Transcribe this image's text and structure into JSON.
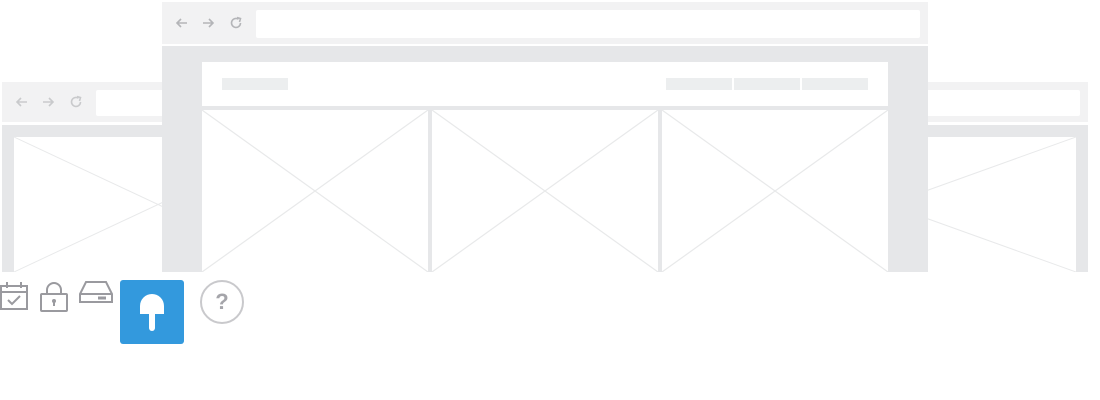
{
  "background_window_left": {
    "nav_icons": [
      "back-arrow-icon",
      "forward-arrow-icon",
      "reload-icon"
    ],
    "address_bar_value": "",
    "content": "image-placeholder"
  },
  "foreground_window": {
    "nav_icons": [
      "back-arrow-icon",
      "forward-arrow-icon",
      "reload-icon"
    ],
    "address_bar_value": "",
    "header_nav_items": 3,
    "columns": [
      "image-placeholder",
      "image-placeholder",
      "image-placeholder"
    ]
  },
  "background_window_right": {
    "address_bar_value": "",
    "content": "image-placeholder"
  },
  "toolbar": {
    "icons": [
      "calendar-check-icon",
      "lock-icon",
      "drive-icon",
      "popsicle-icon",
      "help-icon"
    ],
    "active_icon": "popsicle-icon",
    "help_label": "?"
  },
  "colors": {
    "accent": "#3399dd",
    "icon_gray": "#9a9a9f",
    "chrome": "#f2f2f3",
    "frame": "#e6e7e9",
    "skeleton": "#eceeef"
  }
}
